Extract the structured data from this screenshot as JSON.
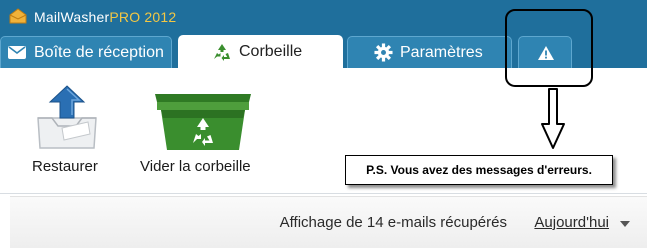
{
  "app": {
    "title_main": "MailWasher",
    "title_pro": "PRO 2012",
    "logo_icon": "mailwasher-logo-icon"
  },
  "tabs": [
    {
      "label": "Boîte de réception",
      "icon": "envelope-icon",
      "active": false
    },
    {
      "label": "Corbeille",
      "icon": "recycle-icon",
      "active": true
    },
    {
      "label": "Paramètres",
      "icon": "gear-icon",
      "active": false
    },
    {
      "label": "",
      "icon": "warning-icon",
      "active": false
    }
  ],
  "toolbar": {
    "restore_label": "Restaurer",
    "restore_icon": "restore-upload-icon",
    "empty_label": "Vider la corbeille",
    "empty_icon": "empty-recycle-bin-icon"
  },
  "status": {
    "text": "Affichage de 14 e-mails récupérés",
    "filter_value": "Aujourd'hui"
  },
  "annotation": {
    "note": "P.S. Vous avez des messages d'erreurs."
  },
  "colors": {
    "titlebar": "#1f6f9c",
    "tab_inactive": "#2f84b2",
    "pro_accent": "#f2c744",
    "recycle_green": "#3a8e2e"
  }
}
